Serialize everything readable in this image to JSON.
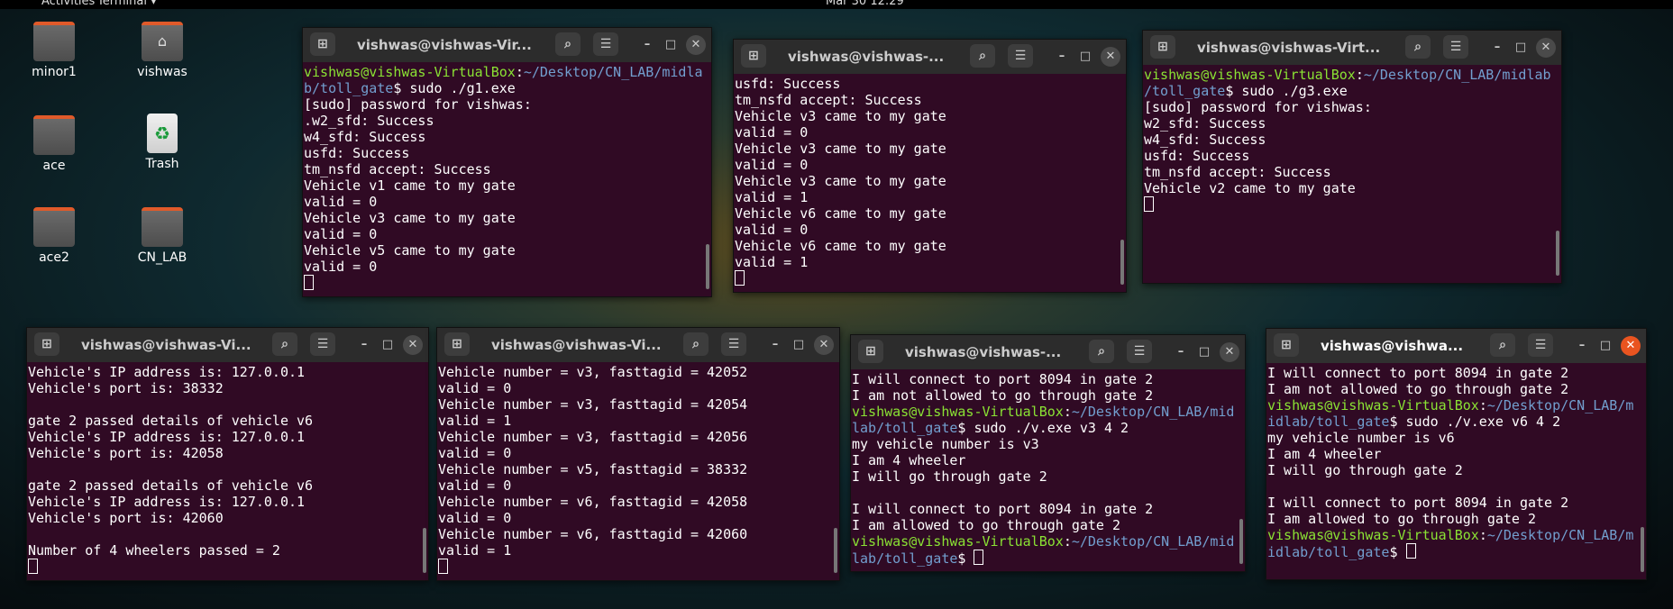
{
  "topbar": {
    "activities": "Activities",
    "app": "Terminal ▾",
    "clock": "Mar 30  12:29"
  },
  "desktop": [
    {
      "label": "minor1"
    },
    {
      "label": "vishwas"
    },
    {
      "label": "ace"
    },
    {
      "label": "Trash"
    },
    {
      "label": "ace2"
    },
    {
      "label": "CN_LAB"
    }
  ],
  "terminals": [
    {
      "title": "vishwas@vishwas-Vir...",
      "lines": [
        {
          "user": "vishwas@vishwas-VirtualBox",
          "path": "~/Desktop/CN_LAB/midla",
          "rest": ""
        },
        {
          "user": "",
          "path": "b/toll_gate",
          "rest": "$ sudo ./g1.exe"
        },
        {
          "text": "[sudo] password for vishwas:"
        },
        {
          "text": ".w2_sfd: Success"
        },
        {
          "text": "w4_sfd: Success"
        },
        {
          "text": "usfd: Success"
        },
        {
          "text": "tm_nsfd accept: Success"
        },
        {
          "text": "Vehicle v1 came to my gate"
        },
        {
          "text": "valid = 0"
        },
        {
          "text": "Vehicle v3 came to my gate"
        },
        {
          "text": "valid = 0"
        },
        {
          "text": "Vehicle v5 came to my gate"
        },
        {
          "text": "valid = 0"
        }
      ]
    },
    {
      "title": "vishwas@vishwas-...",
      "lines": [
        {
          "text": "usfd: Success"
        },
        {
          "text": "tm_nsfd accept: Success"
        },
        {
          "text": "Vehicle v3 came to my gate"
        },
        {
          "text": "valid = 0"
        },
        {
          "text": "Vehicle v3 came to my gate"
        },
        {
          "text": "valid = 0"
        },
        {
          "text": "Vehicle v3 came to my gate"
        },
        {
          "text": "valid = 1"
        },
        {
          "text": "Vehicle v6 came to my gate"
        },
        {
          "text": "valid = 0"
        },
        {
          "text": "Vehicle v6 came to my gate"
        },
        {
          "text": "valid = 1"
        }
      ]
    },
    {
      "title": "vishwas@vishwas-Virt...",
      "lines": [
        {
          "user": "vishwas@vishwas-VirtualBox",
          "path": "~/Desktop/CN_LAB/midlab",
          "rest": ""
        },
        {
          "user": "",
          "path": "/toll_gate",
          "rest": "$ sudo ./g3.exe"
        },
        {
          "text": "[sudo] password for vishwas:"
        },
        {
          "text": "w2_sfd: Success"
        },
        {
          "text": "w4_sfd: Success"
        },
        {
          "text": "usfd: Success"
        },
        {
          "text": "tm_nsfd accept: Success"
        },
        {
          "text": "Vehicle v2 came to my gate"
        }
      ]
    },
    {
      "title": "vishwas@vishwas-Vi...",
      "lines": [
        {
          "text": "Vehicle's IP address is: 127.0.0.1"
        },
        {
          "text": "Vehicle's port is: 38332"
        },
        {
          "text": ""
        },
        {
          "text": "gate 2 passed details of vehicle v6"
        },
        {
          "text": "Vehicle's IP address is: 127.0.0.1"
        },
        {
          "text": "Vehicle's port is: 42058"
        },
        {
          "text": ""
        },
        {
          "text": "gate 2 passed details of vehicle v6"
        },
        {
          "text": "Vehicle's IP address is: 127.0.0.1"
        },
        {
          "text": "Vehicle's port is: 42060"
        },
        {
          "text": ""
        },
        {
          "text": "Number of 4 wheelers passed = 2"
        }
      ]
    },
    {
      "title": "vishwas@vishwas-Vi...",
      "lines": [
        {
          "text": "Vehicle number = v3, fasttagid = 42052"
        },
        {
          "text": "valid = 0"
        },
        {
          "text": "Vehicle number = v3, fasttagid = 42054"
        },
        {
          "text": "valid = 1"
        },
        {
          "text": "Vehicle number = v3, fasttagid = 42056"
        },
        {
          "text": "valid = 0"
        },
        {
          "text": "Vehicle number = v5, fasttagid = 38332"
        },
        {
          "text": "valid = 0"
        },
        {
          "text": "Vehicle number = v6, fasttagid = 42058"
        },
        {
          "text": "valid = 0"
        },
        {
          "text": "Vehicle number = v6, fasttagid = 42060"
        },
        {
          "text": "valid = 1"
        }
      ]
    },
    {
      "title": "vishwas@vishwas-...",
      "lines": [
        {
          "text": "I will connect to port 8094 in gate 2"
        },
        {
          "text": "I am not allowed to go through gate 2"
        },
        {
          "user": "vishwas@vishwas-VirtualBox",
          "path": "~/Desktop/CN_LAB/mid",
          "rest": ""
        },
        {
          "user": "",
          "path": "lab/toll_gate",
          "rest": "$ sudo ./v.exe v3 4 2"
        },
        {
          "text": "my vehicle number is v3"
        },
        {
          "text": "I am 4 wheeler"
        },
        {
          "text": "I will go through gate 2"
        },
        {
          "text": ""
        },
        {
          "text": "I will connect to port 8094 in gate 2"
        },
        {
          "text": "I am allowed to go through gate 2"
        },
        {
          "user": "vishwas@vishwas-VirtualBox",
          "path": "~/Desktop/CN_LAB/mid",
          "rest": ""
        },
        {
          "user": "",
          "path": "lab/toll_gate",
          "rest": "$ ",
          "cursor": true
        }
      ]
    },
    {
      "title": "vishwas@vishwa...",
      "lines": [
        {
          "text": "I will connect to port 8094 in gate 2"
        },
        {
          "text": "I am not allowed to go through gate 2"
        },
        {
          "user": "vishwas@vishwas-VirtualBox",
          "path": "~/Desktop/CN_LAB/m",
          "rest": ""
        },
        {
          "user": "",
          "path": "idlab/toll_gate",
          "rest": "$ sudo ./v.exe v6 4 2"
        },
        {
          "text": "my vehicle number is v6"
        },
        {
          "text": "I am 4 wheeler"
        },
        {
          "text": "I will go through gate 2"
        },
        {
          "text": ""
        },
        {
          "text": "I will connect to port 8094 in gate 2"
        },
        {
          "text": "I am allowed to go through gate 2"
        },
        {
          "user": "vishwas@vishwas-VirtualBox",
          "path": "~/Desktop/CN_LAB/m",
          "rest": ""
        },
        {
          "user": "",
          "path": "idlab/toll_gate",
          "rest": "$ ",
          "cursor": true
        }
      ]
    }
  ]
}
